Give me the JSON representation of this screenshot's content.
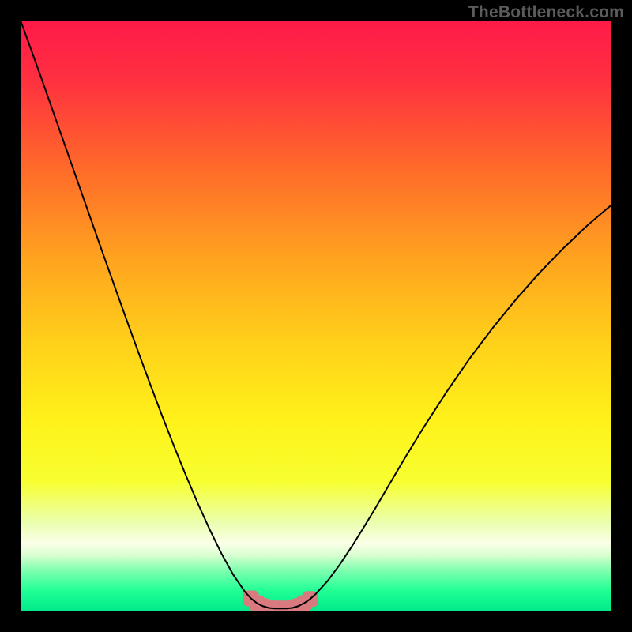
{
  "watermark": "TheBottleneck.com",
  "colors": {
    "curve": "#000000",
    "marker": "#d97a7f",
    "gradient_stops": [
      {
        "offset": 0.0,
        "color": "#ff1a49"
      },
      {
        "offset": 0.1,
        "color": "#ff3040"
      },
      {
        "offset": 0.25,
        "color": "#ff6a2a"
      },
      {
        "offset": 0.4,
        "color": "#ffa21f"
      },
      {
        "offset": 0.55,
        "color": "#ffd21a"
      },
      {
        "offset": 0.68,
        "color": "#fff21a"
      },
      {
        "offset": 0.78,
        "color": "#f7ff30"
      },
      {
        "offset": 0.85,
        "color": "#eaffb0"
      },
      {
        "offset": 0.885,
        "color": "#faffe8"
      },
      {
        "offset": 0.905,
        "color": "#d8ffd0"
      },
      {
        "offset": 0.93,
        "color": "#80ffb0"
      },
      {
        "offset": 0.965,
        "color": "#20ff95"
      },
      {
        "offset": 1.0,
        "color": "#00e88a"
      }
    ]
  },
  "chart_data": {
    "type": "line",
    "title": "",
    "xlabel": "",
    "ylabel": "",
    "xlim": [
      0,
      100
    ],
    "ylim": [
      0,
      100
    ],
    "x": [
      0,
      2,
      4,
      6,
      8,
      10,
      12,
      14,
      16,
      18,
      20,
      22,
      24,
      26,
      28,
      30,
      32,
      34,
      36,
      38,
      39,
      40,
      41,
      42,
      43,
      44,
      45,
      46,
      47,
      48,
      49,
      50,
      52,
      54,
      56,
      58,
      60,
      62,
      65,
      68,
      72,
      76,
      80,
      84,
      88,
      92,
      96,
      100
    ],
    "values": [
      100,
      94.5,
      88.9,
      83.2,
      77.5,
      71.8,
      66.1,
      60.4,
      54.8,
      49.2,
      43.7,
      38.3,
      33.0,
      27.9,
      23.0,
      18.3,
      13.9,
      9.8,
      6.2,
      3.3,
      2.2,
      1.4,
      0.9,
      0.6,
      0.5,
      0.5,
      0.5,
      0.6,
      0.9,
      1.4,
      2.1,
      3.0,
      5.2,
      7.9,
      10.9,
      14.1,
      17.4,
      20.8,
      25.9,
      30.8,
      37.0,
      42.8,
      48.1,
      53.0,
      57.5,
      61.6,
      65.4,
      68.8
    ],
    "optimal_range_x": [
      39,
      49
    ],
    "markers": [
      {
        "x": 39,
        "y": 2.2
      },
      {
        "x": 40,
        "y": 1.4
      },
      {
        "x": 41,
        "y": 0.9
      },
      {
        "x": 42,
        "y": 0.6
      },
      {
        "x": 43,
        "y": 0.5
      },
      {
        "x": 44,
        "y": 0.5
      },
      {
        "x": 45,
        "y": 0.5
      },
      {
        "x": 46,
        "y": 0.6
      },
      {
        "x": 47,
        "y": 0.9
      },
      {
        "x": 48,
        "y": 1.4
      },
      {
        "x": 49,
        "y": 2.1
      }
    ]
  }
}
